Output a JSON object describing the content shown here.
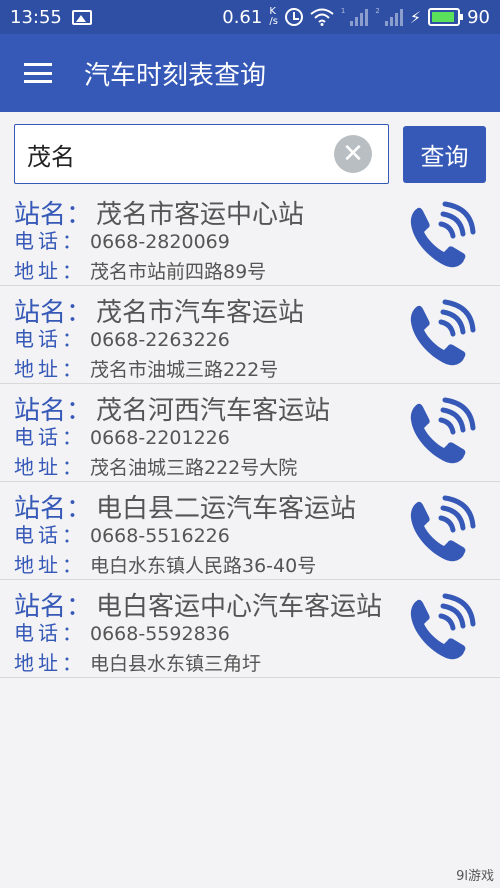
{
  "status_bar": {
    "time": "13:55",
    "net_speed": "0.61",
    "net_speed_unit_top": "K",
    "net_speed_unit_bottom": "/s",
    "sim1_label": "1",
    "sim2_label": "2",
    "battery_level": "90",
    "icons": [
      "image-icon",
      "alarm-icon",
      "wifi-icon",
      "signal-icon",
      "signal-icon",
      "charging-icon",
      "battery-icon"
    ]
  },
  "app_bar": {
    "title": "汽车时刻表查询",
    "menu_icon": "hamburger-menu-icon"
  },
  "search": {
    "value": "茂名",
    "placeholder": "",
    "clear_icon": "close-icon",
    "button_label": "查询"
  },
  "labels": {
    "name": "站名：",
    "phone": "电话：",
    "address": "地址："
  },
  "stations": [
    {
      "name": "茂名市客运中心站",
      "phone": "0668-2820069",
      "address": "茂名市站前四路89号"
    },
    {
      "name": "茂名市汽车客运站",
      "phone": "0668-2263226",
      "address": "茂名市油城三路222号"
    },
    {
      "name": "茂名河西汽车客运站",
      "phone": "0668-2201226",
      "address": "茂名油城三路222号大院"
    },
    {
      "name": "电白县二运汽车客运站",
      "phone": "0668-5516226",
      "address": "电白水东镇人民路36-40号"
    },
    {
      "name": "电白客运中心汽车客运站",
      "phone": "0668-5592836",
      "address": "电白县水东镇三角圩"
    }
  ],
  "colors": {
    "primary": "#3659b8",
    "status_bar": "#2f4fa4",
    "background": "#f3f3f5",
    "battery_fill": "#5be05b"
  },
  "watermark": "9l游戏"
}
